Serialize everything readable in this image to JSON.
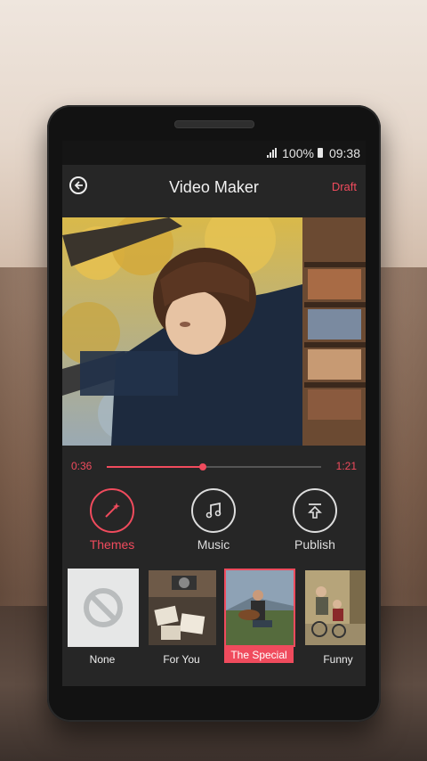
{
  "status": {
    "battery": "100%",
    "time": "09:38"
  },
  "appbar": {
    "title": "Video Maker",
    "draft_label": "Draft"
  },
  "player": {
    "current_time": "0:36",
    "total_time": "1:21",
    "progress": 0.45
  },
  "actions": [
    {
      "label": "Themes",
      "icon": "magic-wand-icon",
      "active": true
    },
    {
      "label": "Music",
      "icon": "music-note-icon",
      "active": false
    },
    {
      "label": "Publish",
      "icon": "upload-icon",
      "active": false
    }
  ],
  "themes": [
    {
      "label": "None",
      "icon": "no-entry-icon"
    },
    {
      "label": "For You"
    },
    {
      "label": "The Special",
      "selected": true
    },
    {
      "label": "Funny"
    }
  ],
  "colors": {
    "accent": "#f04b5d",
    "background": "#262626"
  }
}
